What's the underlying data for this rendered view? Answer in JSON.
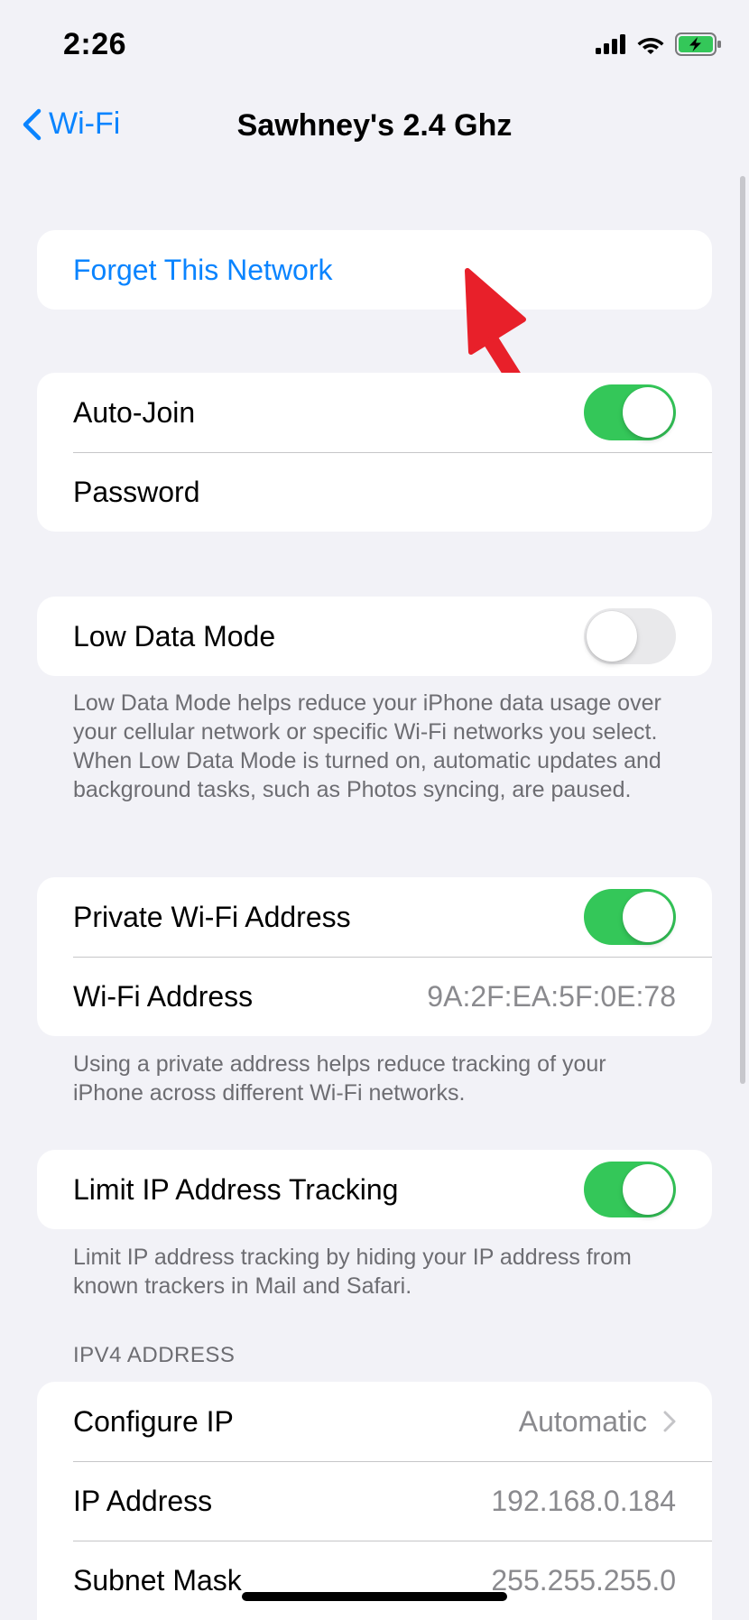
{
  "status_bar": {
    "time": "2:26",
    "icons": [
      "cellular-signal-icon",
      "wifi-icon",
      "battery-charging-icon"
    ],
    "battery_color": "#34c759"
  },
  "nav": {
    "back_label": "Wi-Fi",
    "title": "Sawhney's 2.4 Ghz"
  },
  "forget": {
    "label": "Forget This Network"
  },
  "join_group": {
    "auto_join_label": "Auto-Join",
    "auto_join_on": true,
    "password_label": "Password"
  },
  "low_data": {
    "label": "Low Data Mode",
    "on": false,
    "footnote": "Low Data Mode helps reduce your iPhone data usage over your cellular network or specific Wi-Fi networks you select. When Low Data Mode is turned on, automatic updates and background tasks, such as Photos syncing, are paused."
  },
  "private_address": {
    "label": "Private Wi-Fi Address",
    "on": true,
    "wifi_address_label": "Wi-Fi Address",
    "wifi_address_value": "9A:2F:EA:5F:0E:78",
    "footnote": "Using a private address helps reduce tracking of your iPhone across different Wi-Fi networks."
  },
  "limit_ip": {
    "label": "Limit IP Address Tracking",
    "on": true,
    "footnote": "Limit IP address tracking by hiding your IP address from known trackers in Mail and Safari."
  },
  "ipv4": {
    "header": "IPV4 ADDRESS",
    "configure_label": "Configure IP",
    "configure_value": "Automatic",
    "ip_label": "IP Address",
    "ip_value": "192.168.0.184",
    "subnet_label": "Subnet Mask",
    "subnet_value": "255.255.255.0"
  },
  "colors": {
    "accent": "#0a84ff",
    "toggle_on": "#34c759",
    "toggle_off": "#e9e9eb",
    "arrow": "#e8202a",
    "background": "#f2f2f7"
  }
}
